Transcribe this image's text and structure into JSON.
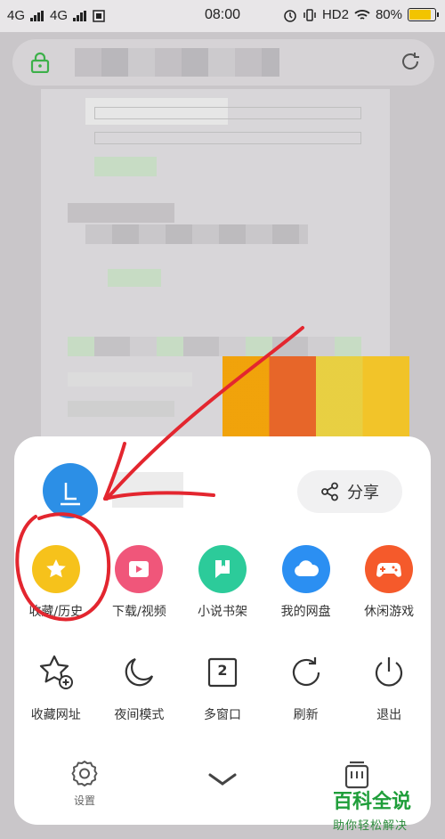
{
  "status_bar": {
    "signal_1": "4G",
    "signal_2": "4G",
    "time": "08:00",
    "hd": "HD2",
    "battery": "80%",
    "battery_level": 0.8
  },
  "sheet": {
    "share_label": "分享",
    "row1": [
      {
        "label": "收藏/历史",
        "icon": "star-icon",
        "color": "#f6c21b"
      },
      {
        "label": "下载/视频",
        "icon": "play-icon",
        "color": "#f0567a"
      },
      {
        "label": "小说书架",
        "icon": "book-icon",
        "color": "#2ccb9a"
      },
      {
        "label": "我的网盘",
        "icon": "cloud-icon",
        "color": "#2b8ff2"
      },
      {
        "label": "休闲游戏",
        "icon": "gamepad-icon",
        "color": "#f55a2b"
      }
    ],
    "row2": [
      {
        "label": "收藏网址",
        "icon": "star-add-icon"
      },
      {
        "label": "夜间模式",
        "icon": "moon-icon"
      },
      {
        "label": "多窗口",
        "icon": "window-count-icon",
        "badge": "2"
      },
      {
        "label": "刷新",
        "icon": "refresh-icon"
      },
      {
        "label": "退出",
        "icon": "power-icon"
      }
    ],
    "settings_label": "设置"
  },
  "watermark": {
    "title": "百科全说",
    "subtitle": "助你轻松解决"
  }
}
